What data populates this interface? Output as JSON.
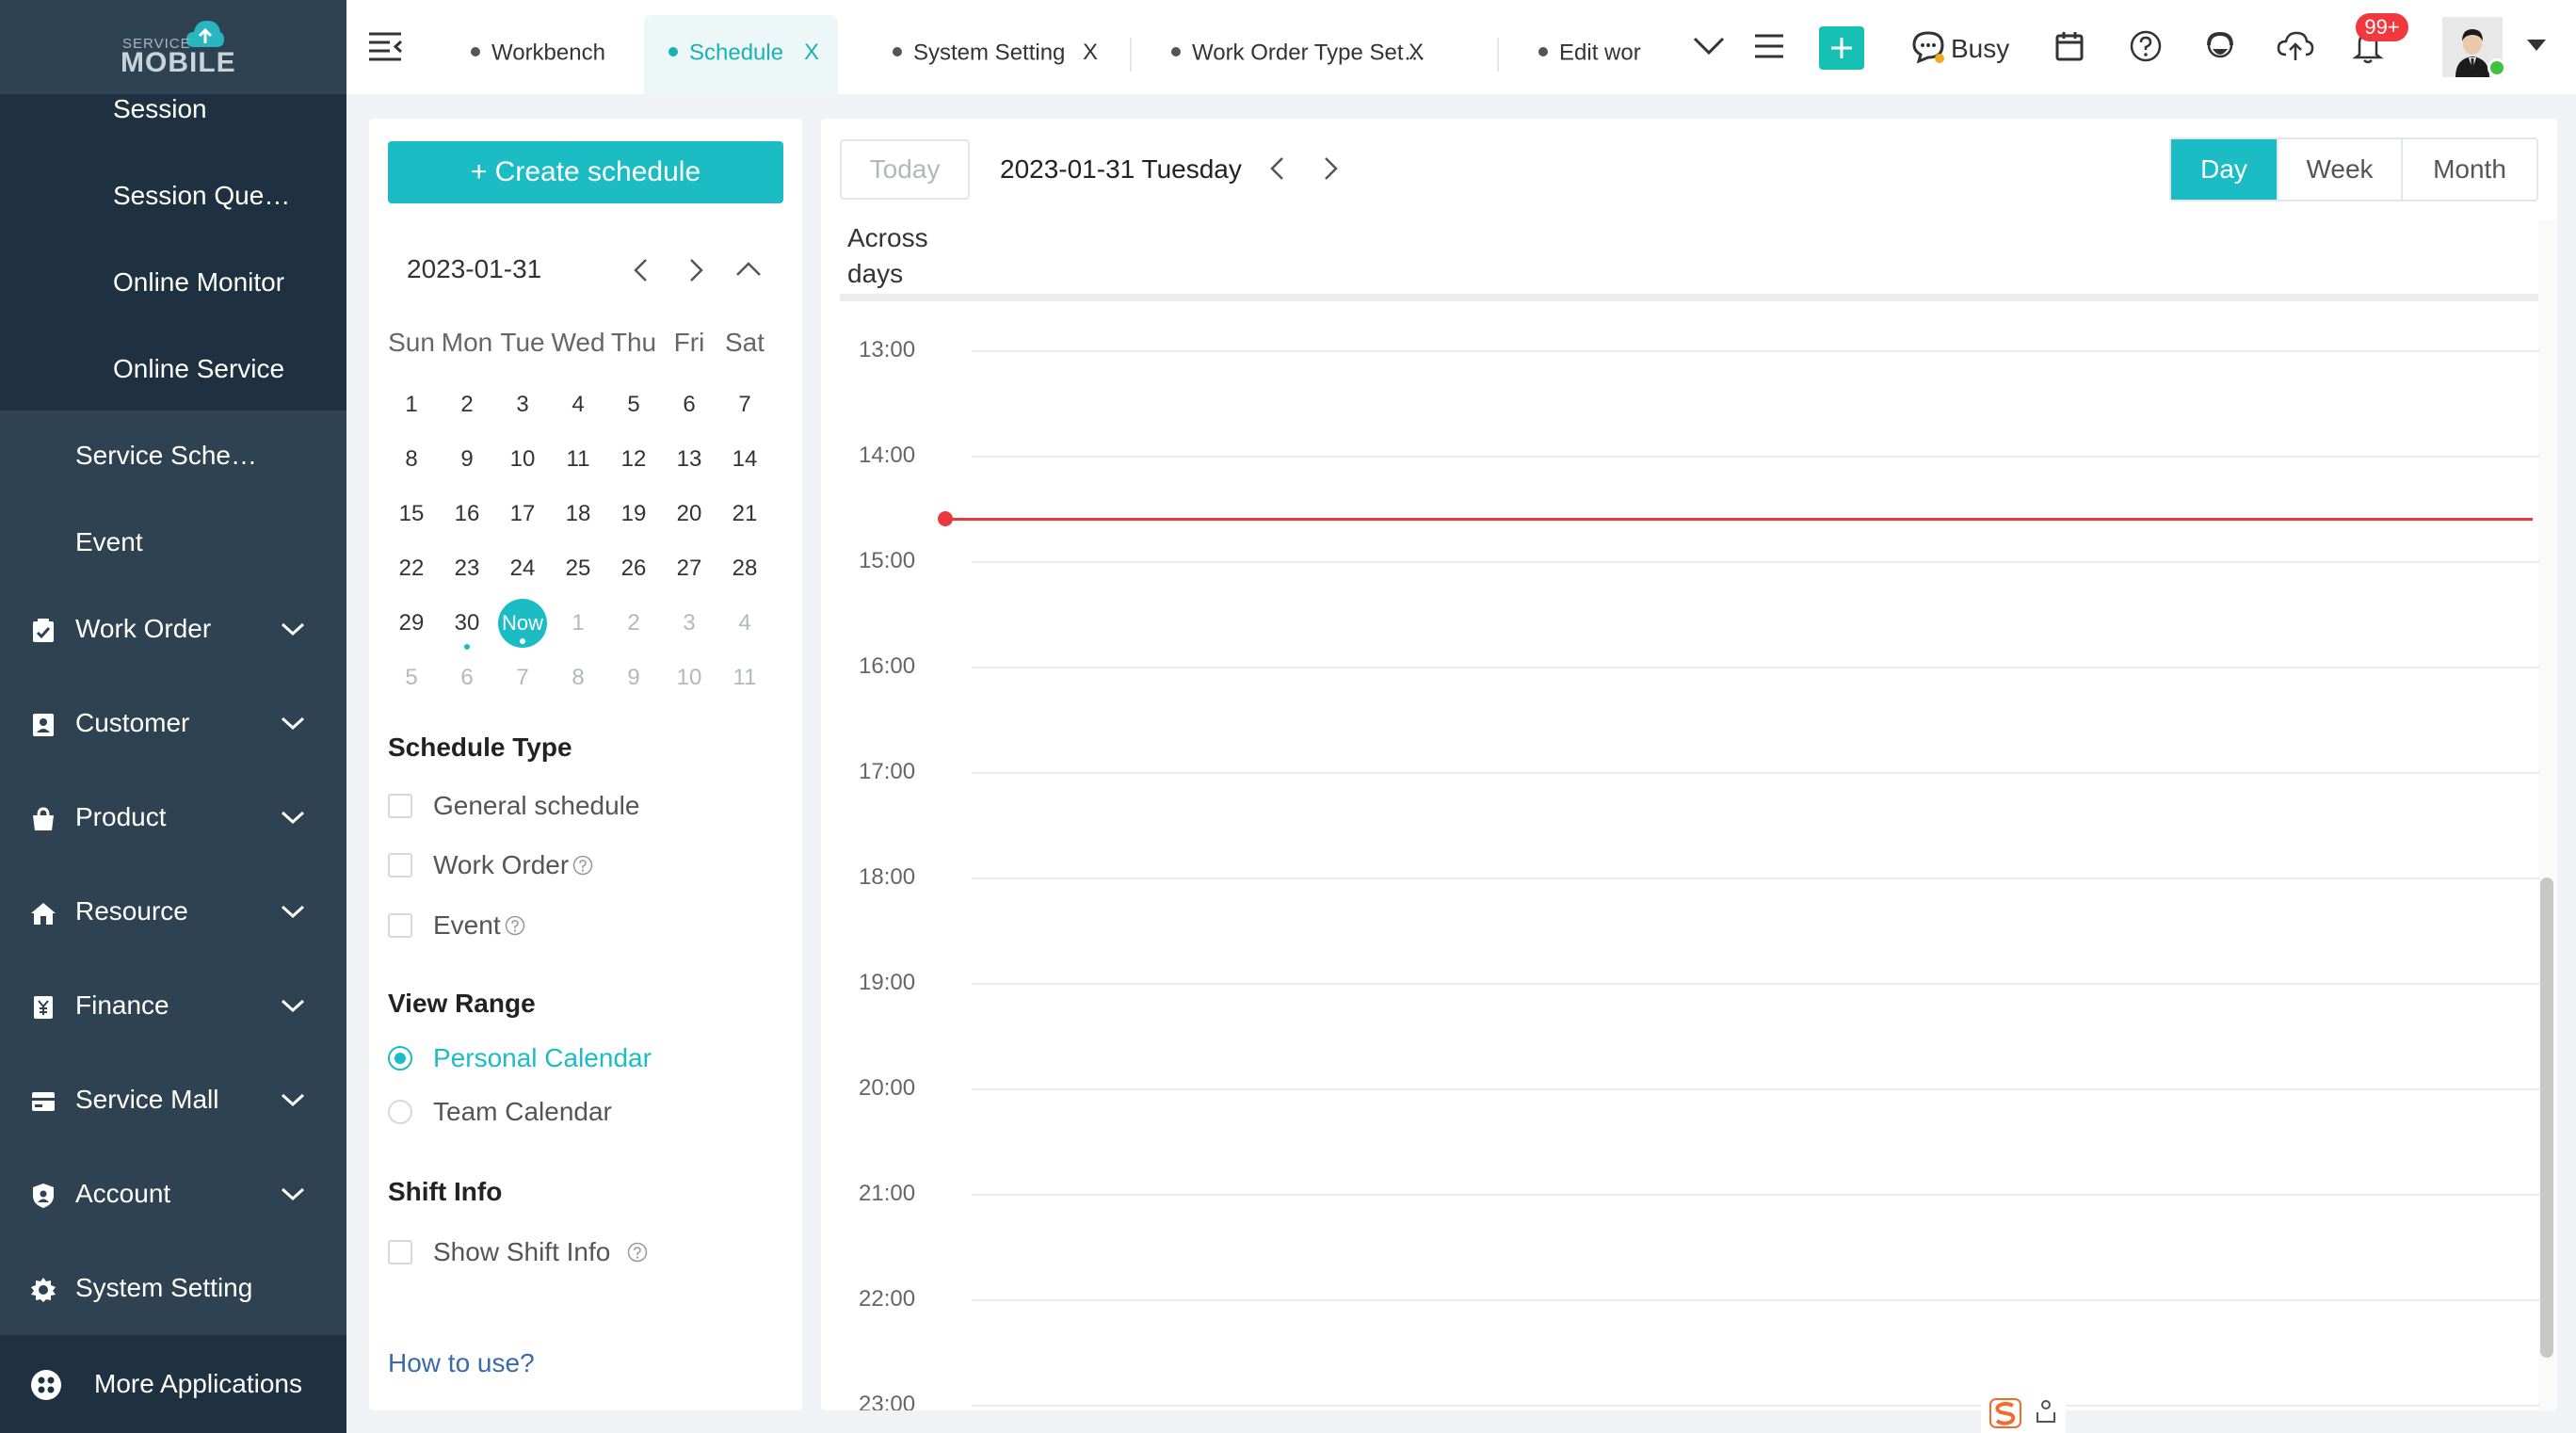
{
  "sidebar": {
    "logo_small": "SERVICE",
    "logo_big": "MOBILE",
    "sub_items": [
      {
        "label": "Session"
      },
      {
        "label": "Session Que…"
      },
      {
        "label": "Online Monitor"
      },
      {
        "label": "Online Service"
      }
    ],
    "level2_items": [
      {
        "label": "Service Sche…"
      },
      {
        "label": "Event"
      }
    ],
    "menus": [
      {
        "label": "Work Order",
        "icon": "work-order-icon"
      },
      {
        "label": "Customer",
        "icon": "customer-icon"
      },
      {
        "label": "Product",
        "icon": "product-icon"
      },
      {
        "label": "Resource",
        "icon": "resource-icon"
      },
      {
        "label": "Finance",
        "icon": "finance-icon"
      },
      {
        "label": "Service Mall",
        "icon": "service-mall-icon"
      },
      {
        "label": "Account",
        "icon": "account-icon"
      },
      {
        "label": "System Setting",
        "icon": "gear-icon"
      }
    ],
    "more_apps": "More Applications"
  },
  "tabs": [
    {
      "label": "Workbench",
      "closable": false,
      "active": false
    },
    {
      "label": "Schedule",
      "closable": true,
      "active": true
    },
    {
      "label": "System Setting",
      "closable": true,
      "active": false
    },
    {
      "label": "Work Order Type Set…",
      "closable": true,
      "active": false
    },
    {
      "label": "Edit wor",
      "closable": false,
      "active": false
    }
  ],
  "tab_close_glyph": "X",
  "header": {
    "status": "Busy",
    "notification_count": "99+",
    "accent_color": "#17c0b4"
  },
  "left_panel": {
    "create_button": "+ Create schedule",
    "mini_calendar": {
      "date": "2023-01-31",
      "weekdays": [
        "Sun",
        "Mon",
        "Tue",
        "Wed",
        "Thu",
        "Fri",
        "Sat"
      ],
      "weeks": [
        [
          "1",
          "2",
          "3",
          "4",
          "5",
          "6",
          "7"
        ],
        [
          "8",
          "9",
          "10",
          "11",
          "12",
          "13",
          "14"
        ],
        [
          "15",
          "16",
          "17",
          "18",
          "19",
          "20",
          "21"
        ],
        [
          "22",
          "23",
          "24",
          "25",
          "26",
          "27",
          "28"
        ],
        [
          "29",
          "30",
          "Now",
          "1",
          "2",
          "3",
          "4"
        ],
        [
          "5",
          "6",
          "7",
          "8",
          "9",
          "10",
          "11"
        ]
      ]
    },
    "schedule_type": {
      "title": "Schedule Type",
      "options": [
        "General schedule",
        "Work Order",
        "Event"
      ]
    },
    "view_range": {
      "title": "View Range",
      "options": [
        "Personal Calendar",
        "Team Calendar"
      ],
      "selected": "Personal Calendar"
    },
    "shift_info": {
      "title": "Shift Info",
      "option": "Show Shift Info"
    },
    "help_link": "How to use?"
  },
  "calendar": {
    "today_button": "Today",
    "current_date": "2023-01-31 Tuesday",
    "views": [
      "Day",
      "Week",
      "Month"
    ],
    "active_view": "Day",
    "across_days": "Across days",
    "hours": [
      "13:00",
      "14:00",
      "15:00",
      "16:00",
      "17:00",
      "18:00",
      "19:00",
      "20:00",
      "21:00",
      "22:00",
      "23:00"
    ]
  }
}
